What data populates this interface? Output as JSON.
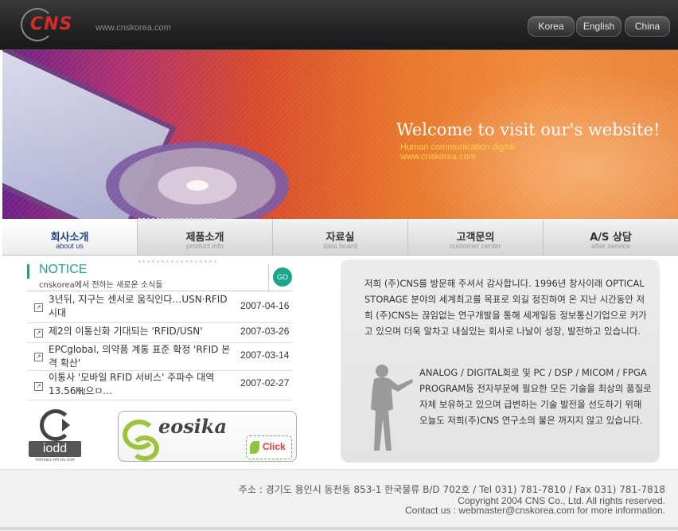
{
  "header": {
    "logo_text": "CNS",
    "url": "www.cnskorea.com",
    "languages": [
      "Korea",
      "English",
      "China"
    ]
  },
  "banner": {
    "headline": "Welcome to visit our's website!",
    "subline1": "Human communication digital",
    "subline2": "www.cnskorea.com"
  },
  "menu": [
    {
      "ko": "회사소개",
      "en": "about us"
    },
    {
      "ko": "제품소개",
      "en": "product info"
    },
    {
      "ko": "자료실",
      "en": "data board"
    },
    {
      "ko": "고객문의",
      "en": "customer center"
    },
    {
      "ko": "A/S 상담",
      "en": "after service"
    }
  ],
  "notice": {
    "title": "NOTICE",
    "subtitle": "cnskorea에서 전하는 새로운 소식들",
    "go_label": "GO",
    "items": [
      {
        "title": "3년뒤, 지구는 센서로 움직인다…USN·RFID 시대",
        "date": "2007-04-16"
      },
      {
        "title": "제2의 이통신화 기대되는 'RFID/USN'",
        "date": "2007-03-26"
      },
      {
        "title": "EPCglobal, 의약품 계통 표준 확정 'RFID 본격 확산'",
        "date": "2007-03-14"
      },
      {
        "title": "이통사 '모바일 RFID 서비스' 주파수 대역 13.56㎒으ㅁ...",
        "date": "2007-02-27"
      }
    ]
  },
  "logos": {
    "iodd": "iodd",
    "iodd_sub": "PORTABLE VIRTUAL ROM",
    "eosika": "eosika",
    "click": "Click"
  },
  "greeting": {
    "para1": "저희 (주)CNS를 방문해 주셔서 감사합니다. 1996년 창사이래 OPTICAL STORAGE 분야의 세계최고를 목표로 외길 정진하여 온 지난 시간동안 저희 (주)CNS는 끊임없는 연구개발을 통해 세계일등 정보통신기업으로 커가고 있으며 더욱 알차고 내실있는 회사로 나날이 성장, 발전하고 있습니다.",
    "para2": "ANALOG / DIGITAL회로 및 PC / DSP / MICOM / FPGA PROGRAM등 전자부문에 필요한 모든 기술을 최상의 품질로 자체 보유하고 있으며 급변하는 기술 발전을 선도하기 위해 오늘도 저희(주)CNS 연구소의 불은 꺼지지 않고 있습니다."
  },
  "footer": {
    "address": "주소 : 경기도 용인시 동천동 853-1 한국물류 B/D 702호  /  Tel 031) 781-7810  /  Fax 031) 781-7818",
    "copyright": "Copyright 2004 CNS Co., Ltd. All rights reserved.",
    "contact_prefix": "Contact us : ",
    "contact_email": "webmaster@cnskorea.com",
    "contact_suffix": " for more information."
  }
}
